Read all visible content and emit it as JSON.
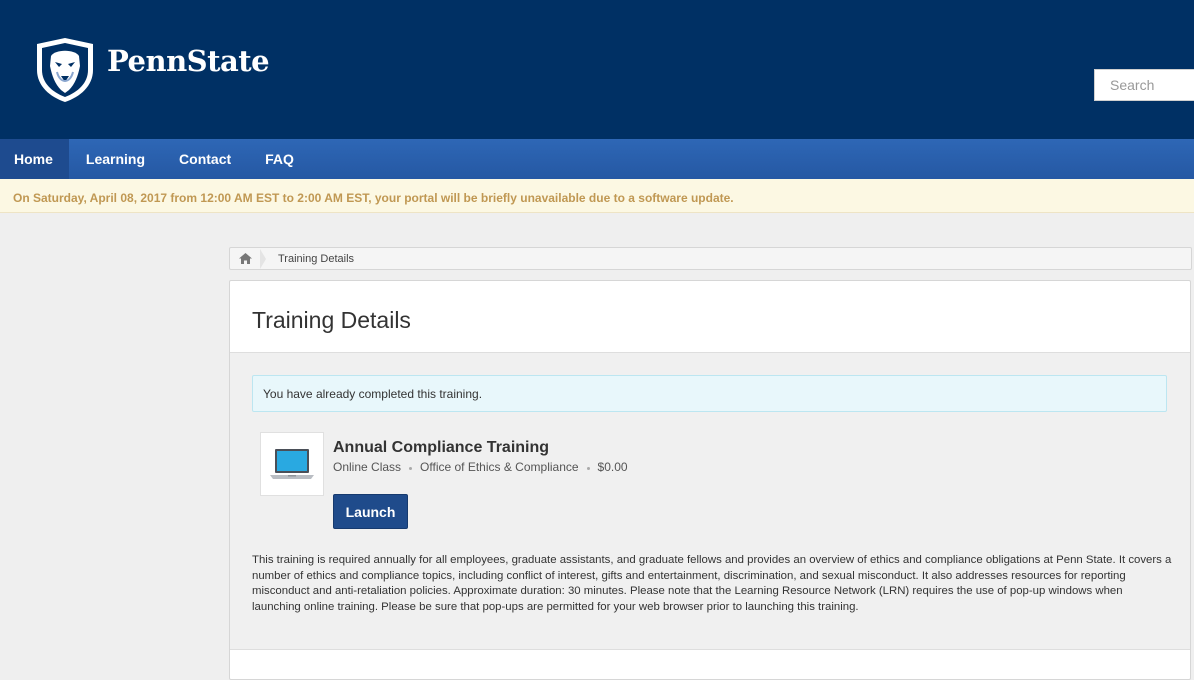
{
  "header": {
    "brand": "PennState",
    "search_placeholder": "Search"
  },
  "nav": {
    "items": [
      {
        "label": "Home",
        "active": true
      },
      {
        "label": "Learning"
      },
      {
        "label": "Contact"
      },
      {
        "label": "FAQ"
      }
    ]
  },
  "alert": {
    "text": "On Saturday, April 08, 2017 from 12:00 AM EST to 2:00 AM EST, your portal will be briefly unavailable due to a software update."
  },
  "breadcrumb": {
    "home_icon": "home-icon",
    "current": "Training Details"
  },
  "page": {
    "title": "Training Details",
    "completed_message": "You have already completed this training."
  },
  "course": {
    "icon": "laptop-icon",
    "title": "Annual Compliance Training",
    "type": "Online Class",
    "provider": "Office of Ethics & Compliance",
    "price": "$0.00",
    "launch_label": "Launch",
    "description": "This training is required annually for all employees, graduate assistants, and graduate fellows and provides an overview of ethics and compliance obligations at Penn State. It covers a number of ethics and compliance topics, including conflict of interest, gifts and entertainment, discrimination, and sexual misconduct. It also addresses resources for reporting misconduct and anti-retaliation policies. Approximate duration: 30 minutes. Please note that the Learning Resource Network (LRN) requires the use of pop-up windows when launching online training. Please be sure that pop-ups are permitted for your web browser prior to launching this training."
  },
  "colors": {
    "header_bg": "#003064",
    "nav_bg": "#2e67b6",
    "alert_text": "#c09853",
    "button_bg": "#1f4b8b"
  }
}
